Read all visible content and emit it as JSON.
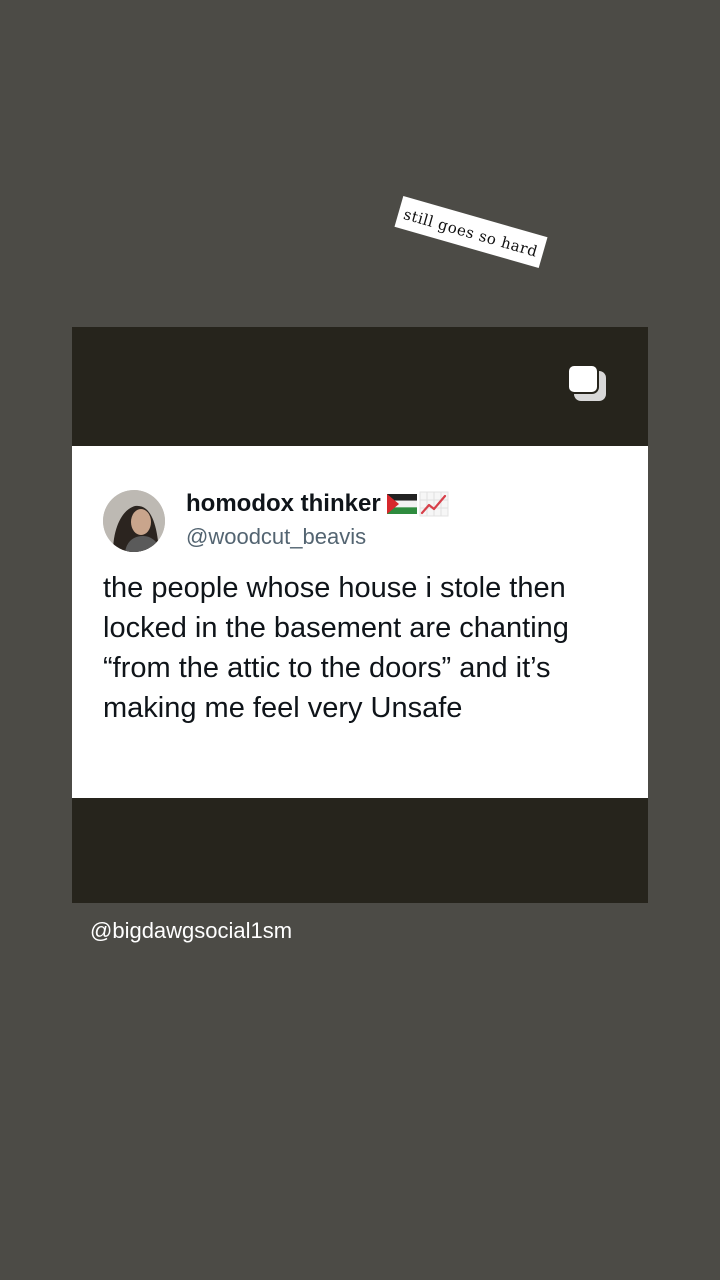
{
  "sticker": {
    "text": "still goes so hard"
  },
  "post": {
    "multi_icon": "carousel-multiple-icon",
    "tweet": {
      "display_name": "homodox thinker",
      "handle": "@woodcut_beavis",
      "text": "the people whose house i stole then locked in the basement are chanting “from the attic to the doors” and it’s making me feel very Unsafe",
      "flag_icon": "palestine-flag-icon",
      "emoji_icon": "chart-increasing-icon"
    }
  },
  "credit": {
    "text": "@bigdawgsocial1sm"
  },
  "colors": {
    "background": "#4c4b46",
    "post_frame": "#26241c",
    "tweet_card": "#ffffff",
    "handle": "#536471"
  }
}
